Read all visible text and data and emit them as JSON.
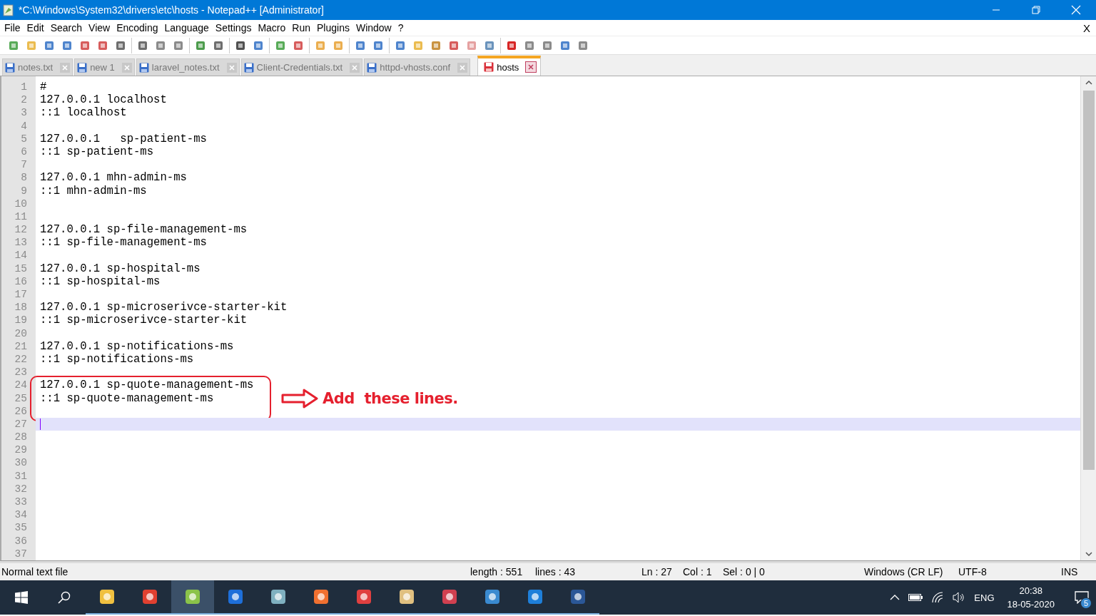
{
  "window": {
    "title": "*C:\\Windows\\System32\\drivers\\etc\\hosts - Notepad++ [Administrator]"
  },
  "menu": [
    "File",
    "Edit",
    "Search",
    "View",
    "Encoding",
    "Language",
    "Settings",
    "Macro",
    "Run",
    "Plugins",
    "Window",
    "?"
  ],
  "menu_close": "X",
  "tabs": [
    {
      "label": "notes.txt",
      "selected": false,
      "modified": false
    },
    {
      "label": "new 1",
      "selected": false,
      "modified": false
    },
    {
      "label": "laravel_notes.txt",
      "selected": false,
      "modified": false
    },
    {
      "label": "Client-Credentials.txt",
      "selected": false,
      "modified": false
    },
    {
      "label": "httpd-vhosts.conf",
      "selected": false,
      "modified": false
    },
    {
      "label": "hosts",
      "selected": true,
      "modified": true
    }
  ],
  "editor": {
    "lines": [
      {
        "number": "1",
        "text": "#",
        "current": false,
        "boxed": false
      },
      {
        "number": "2",
        "text": "127.0.0.1 localhost",
        "current": false,
        "boxed": false
      },
      {
        "number": "3",
        "text": "::1 localhost",
        "current": false,
        "boxed": false
      },
      {
        "number": "4",
        "current": false,
        "boxed": false
      },
      {
        "number": "5",
        "text": "127.0.0.1   sp-patient-ms",
        "current": false,
        "boxed": false
      },
      {
        "number": "6",
        "text": "::1 sp-patient-ms",
        "current": false,
        "boxed": false
      },
      {
        "number": "7",
        "current": false,
        "boxed": false
      },
      {
        "number": "8",
        "text": "127.0.0.1 mhn-admin-ms",
        "current": false,
        "boxed": false
      },
      {
        "number": "9",
        "text": "::1 mhn-admin-ms",
        "current": false,
        "boxed": false
      },
      {
        "number": "10",
        "current": false,
        "boxed": false
      },
      {
        "number": "11",
        "current": false,
        "boxed": false
      },
      {
        "number": "12",
        "text": "127.0.0.1 sp-file-management-ms",
        "current": false,
        "boxed": false
      },
      {
        "number": "13",
        "text": "::1 sp-file-management-ms",
        "current": false,
        "boxed": false
      },
      {
        "number": "14",
        "current": false,
        "boxed": false
      },
      {
        "number": "15",
        "text": "127.0.0.1 sp-hospital-ms",
        "current": false,
        "boxed": false
      },
      {
        "number": "16",
        "text": "::1 sp-hospital-ms",
        "current": false,
        "boxed": false
      },
      {
        "number": "17",
        "current": false,
        "boxed": false
      },
      {
        "number": "18",
        "text": "127.0.0.1 sp-microserivce-starter-kit",
        "current": false,
        "boxed": false
      },
      {
        "number": "19",
        "text": "::1 sp-microserivce-starter-kit",
        "current": false,
        "boxed": false
      },
      {
        "number": "20",
        "current": false,
        "boxed": false
      },
      {
        "number": "21",
        "text": "127.0.0.1 sp-notifications-ms",
        "current": false,
        "boxed": false
      },
      {
        "number": "22",
        "text": "::1 sp-notifications-ms",
        "current": false,
        "boxed": false
      },
      {
        "number": "23",
        "current": false,
        "boxed": false
      },
      {
        "number": "24",
        "text": "127.0.0.1 sp-quote-management-ms",
        "current": false,
        "boxed": true
      },
      {
        "number": "25",
        "text": "::1 sp-quote-management-ms",
        "current": false,
        "boxed": true
      },
      {
        "number": "26",
        "current": false,
        "boxed": true
      },
      {
        "number": "27",
        "current": true,
        "boxed": false
      },
      {
        "number": "28",
        "current": false,
        "boxed": false
      },
      {
        "number": "29",
        "current": false,
        "boxed": false
      },
      {
        "number": "30",
        "current": false,
        "boxed": false
      },
      {
        "number": "31",
        "current": false,
        "boxed": false
      },
      {
        "number": "32",
        "current": false,
        "boxed": false
      },
      {
        "number": "33",
        "current": false,
        "boxed": false
      },
      {
        "number": "34",
        "current": false,
        "boxed": false
      },
      {
        "number": "35",
        "current": false,
        "boxed": false
      },
      {
        "number": "36",
        "current": false,
        "boxed": false
      },
      {
        "number": "37",
        "current": false,
        "boxed": false
      }
    ],
    "annotation": "Add  these lines."
  },
  "status_bar": [
    "Normal text file",
    "length : 551",
    "lines : 43",
    "Ln : 27",
    "Col : 1",
    "Sel : 0 | 0",
    "Windows (CR LF)",
    "UTF-8",
    "INS"
  ],
  "taskbar": {
    "apps": [
      {
        "selected": false
      },
      {
        "selected": false
      },
      {
        "selected": true
      },
      {
        "selected": false
      },
      {
        "selected": false
      },
      {
        "selected": false
      },
      {
        "selected": false
      },
      {
        "selected": false
      },
      {
        "selected": false
      },
      {
        "selected": false
      },
      {
        "selected": false
      },
      {
        "selected": false
      }
    ],
    "language": "ENG",
    "time": "20:38",
    "date": "18-05-2020",
    "notifications": "5"
  }
}
